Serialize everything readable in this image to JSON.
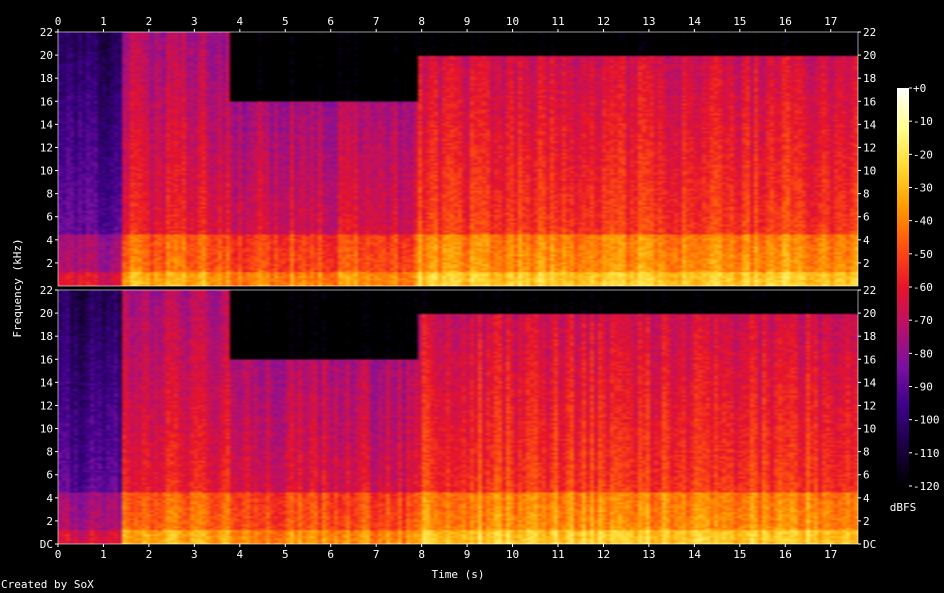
{
  "chart_data": {
    "type": "heatmap",
    "title": "",
    "xlabel": "Time (s)",
    "ylabel": "Frequency (kHz)",
    "channels": 2,
    "xlim": [
      0,
      17.6
    ],
    "ylim": [
      0,
      22
    ],
    "x_ticks": [
      0,
      1,
      2,
      3,
      4,
      5,
      6,
      7,
      8,
      9,
      10,
      11,
      12,
      13,
      14,
      15,
      16,
      17
    ],
    "y_ticks_labels": [
      "DC",
      "2",
      "4",
      "6",
      "8",
      "10",
      "12",
      "14",
      "16",
      "18",
      "20",
      "22"
    ],
    "y_ticks_values": [
      0,
      2,
      4,
      6,
      8,
      10,
      12,
      14,
      16,
      18,
      20,
      22
    ],
    "colorbar": {
      "label": "dBFS",
      "range": [
        -120,
        0
      ],
      "ticks": [
        "+0",
        "-10",
        "-20",
        "-30",
        "-40",
        "-50",
        "-60",
        "-70",
        "-80",
        "-90",
        "-100",
        "-110",
        "-120"
      ],
      "colors": [
        "#000000",
        "#1a0040",
        "#3c0088",
        "#7a10a0",
        "#b8106a",
        "#e8142a",
        "#ff5010",
        "#ff9a00",
        "#ffd830",
        "#ffff90",
        "#ffffff"
      ]
    },
    "segments": [
      {
        "t": [
          0.0,
          1.4
        ],
        "ceiling_khz": 22,
        "level_db": -85
      },
      {
        "t": [
          1.4,
          3.8
        ],
        "ceiling_khz": 22,
        "level_db": -55
      },
      {
        "t": [
          3.8,
          7.9
        ],
        "ceiling_khz": 16,
        "level_db": -60
      },
      {
        "t": [
          7.9,
          17.6
        ],
        "ceiling_khz": 20,
        "level_db": -48
      }
    ]
  },
  "credit": "Created by SoX"
}
